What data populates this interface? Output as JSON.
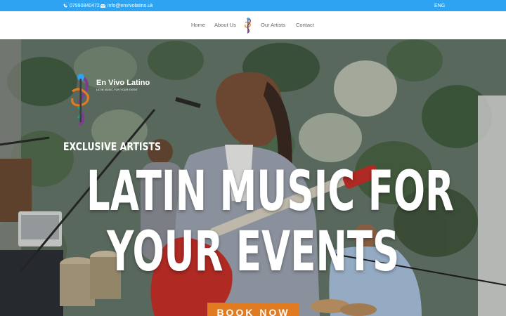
{
  "topbar": {
    "phone": "07990840472",
    "email": "info@envivolatino.uk",
    "language": "ENG"
  },
  "nav": {
    "items": [
      "Home",
      "About Us",
      "Our Artists",
      "Contact"
    ]
  },
  "hero": {
    "brand_name": "En Vivo Latino",
    "brand_tagline": "LATIN MUSIC FOR YOUR EVENT",
    "eyebrow": "EXCLUSIVE ARTISTS",
    "headline_line1": "LATIN MUSIC FOR",
    "headline_line2": "YOUR EVENTS",
    "cta_label": "BOOK NOW"
  },
  "colors": {
    "topbar": "#2ea3f2",
    "cta": "#e07b22",
    "nav_text": "#666666"
  },
  "icons": [
    "phone-icon",
    "email-icon",
    "logo-icon",
    "guitar-clef-logo"
  ]
}
